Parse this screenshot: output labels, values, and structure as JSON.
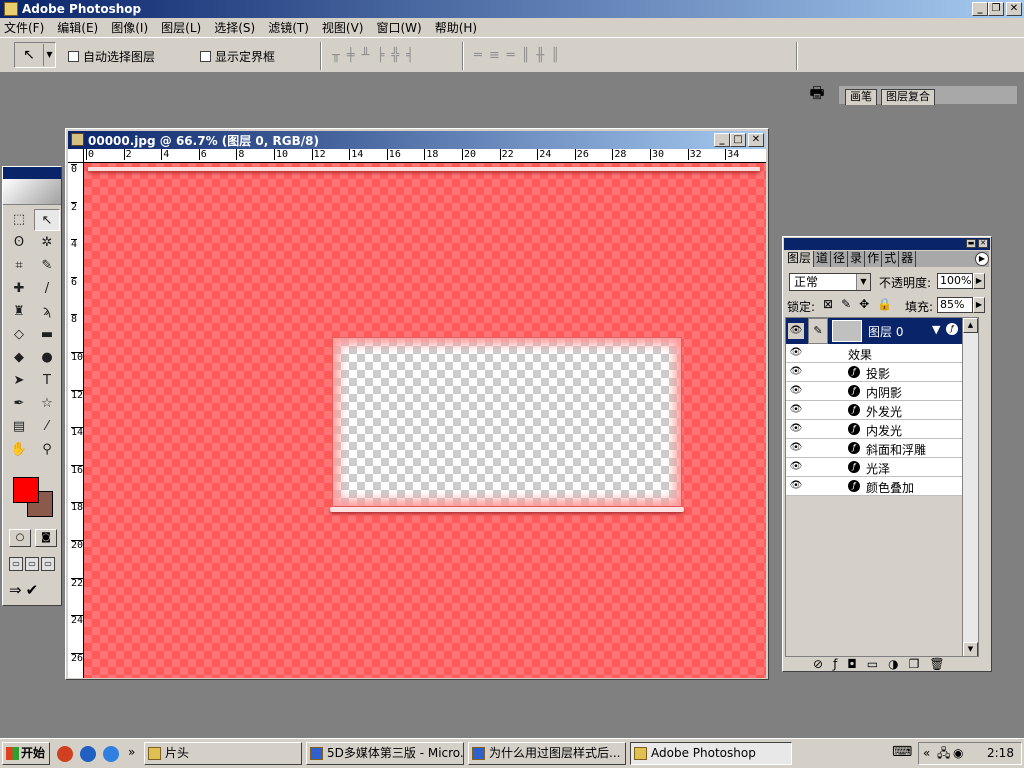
{
  "app": {
    "title": "Adobe Photoshop"
  },
  "menu": [
    "文件(F)",
    "编辑(E)",
    "图像(I)",
    "图层(L)",
    "选择(S)",
    "滤镜(T)",
    "视图(V)",
    "窗口(W)",
    "帮助(H)"
  ],
  "options": {
    "auto_select_label": "自动选择图层",
    "show_bounds_label": "显示定界框",
    "well_tabs": [
      "画笔",
      "图层复合"
    ]
  },
  "document": {
    "title": "00000.jpg @ 66.7% (图层 0, RGB/8)",
    "ruler_h": [
      "0",
      "2",
      "4",
      "6",
      "8",
      "10",
      "12",
      "14",
      "16",
      "18",
      "20",
      "22",
      "24",
      "26",
      "28",
      "30",
      "32",
      "34"
    ],
    "ruler_v": [
      "0",
      "2",
      "4",
      "6",
      "8",
      "10",
      "12",
      "14",
      "16",
      "18",
      "20",
      "22",
      "24",
      "26"
    ]
  },
  "layers": {
    "tabs": [
      "图层",
      "道",
      "径",
      "录",
      "作",
      "式",
      "器"
    ],
    "blend_mode": "正常",
    "opacity_label": "不透明度:",
    "opacity": "100%",
    "lock_label": "锁定:",
    "fill_label": "填充:",
    "fill": "85%",
    "layer_name": "图层 0",
    "effects_label": "效果",
    "effects": [
      "投影",
      "内阴影",
      "外发光",
      "内发光",
      "斜面和浮雕",
      "光泽",
      "颜色叠加"
    ]
  },
  "taskbar": {
    "start": "开始",
    "tasks": [
      "片头",
      "5D多媒体第三版 - Micro...",
      "为什么用过图层样式后...",
      "Adobe Photoshop"
    ],
    "clock": "2:18"
  },
  "colors": {
    "foreground": "#ff0000",
    "background": "#8c5a4a",
    "title_blue": "#0a246a"
  }
}
